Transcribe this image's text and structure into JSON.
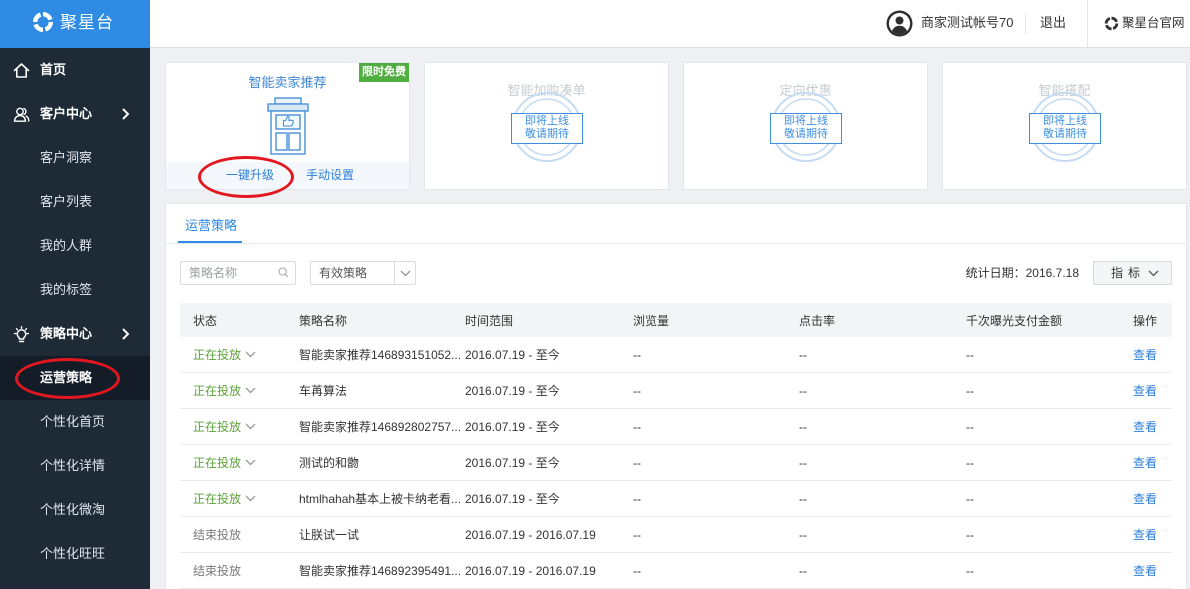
{
  "app": {
    "logo_text": "聚星台",
    "logo_icon": "juxingtai-logo-icon"
  },
  "header": {
    "avatar_icon": "user-avatar-icon",
    "account_name": "商家测试帐号70",
    "logout_label": "退出",
    "official_site_label": "聚星台官网"
  },
  "sidebar": {
    "items": [
      {
        "label": "首页",
        "icon": "home-icon"
      },
      {
        "label": "客户中心",
        "icon": "user-group-icon",
        "expandable": true
      },
      {
        "label": "客户洞察"
      },
      {
        "label": "客户列表"
      },
      {
        "label": "我的人群"
      },
      {
        "label": "我的标签"
      },
      {
        "label": "策略中心",
        "icon": "bulb-icon",
        "expandable": true
      },
      {
        "label": "运营策略",
        "selected": true
      },
      {
        "label": "个性化首页"
      },
      {
        "label": "个性化详情"
      },
      {
        "label": "个性化微淘"
      },
      {
        "label": "个性化旺旺"
      }
    ]
  },
  "feature_cards": [
    {
      "title": "智能卖家推荐",
      "badge": "限时免费",
      "icon": "shop-thumbs-up-icon",
      "actions": [
        "一键升级",
        "手动设置"
      ]
    },
    {
      "title": "智能加购凑单",
      "stamp": [
        "即将上线",
        "敬请期待"
      ]
    },
    {
      "title": "定向优惠",
      "stamp": [
        "即将上线",
        "敬请期待"
      ]
    },
    {
      "title": "智能搭配",
      "stamp": [
        "即将上线",
        "敬请期待"
      ]
    }
  ],
  "panel": {
    "tab_label": "运营策略",
    "search_placeholder": "策略名称",
    "filter_value": "有效策略",
    "stat_date": "统计日期：2016.7.18",
    "metrics_button": "指标"
  },
  "table": {
    "columns": [
      "状态",
      "策略名称",
      "时间范围",
      "浏览量",
      "点击率",
      "千次曝光支付金额",
      "操作"
    ],
    "rows": [
      {
        "status": "正在投放",
        "name": "智能卖家推荐146893151052...",
        "time_range": "2016.07.19 - 至今",
        "views": "--",
        "click_rate": "--",
        "gmv_per_mille": "--",
        "action": "查看"
      },
      {
        "status": "正在投放",
        "name": "车苒算法",
        "time_range": "2016.07.19 - 至今",
        "views": "--",
        "click_rate": "--",
        "gmv_per_mille": "--",
        "action": "查看"
      },
      {
        "status": "正在投放",
        "name": "智能卖家推荐146892802757...",
        "time_range": "2016.07.19 - 至今",
        "views": "--",
        "click_rate": "--",
        "gmv_per_mille": "--",
        "action": "查看"
      },
      {
        "status": "正在投放",
        "name": "测试的和朆",
        "time_range": "2016.07.19 - 至今",
        "views": "--",
        "click_rate": "--",
        "gmv_per_mille": "--",
        "action": "查看"
      },
      {
        "status": "正在投放",
        "name": "htmlhahah基本上被卡纳老看...",
        "time_range": "2016.07.19 - 至今",
        "views": "--",
        "click_rate": "--",
        "gmv_per_mille": "--",
        "action": "查看"
      },
      {
        "status": "结束投放",
        "name": "让朕试一试",
        "time_range": "2016.07.19 - 2016.07.19",
        "views": "--",
        "click_rate": "--",
        "gmv_per_mille": "--",
        "action": "查看"
      },
      {
        "status": "结束投放",
        "name": "智能卖家推荐146892395491...",
        "time_range": "2016.07.19 - 2016.07.19",
        "views": "--",
        "click_rate": "--",
        "gmv_per_mille": "--",
        "action": "查看"
      }
    ]
  },
  "colors": {
    "sidebar_bg": "#1f2a37",
    "logo_bar_bg": "#2f8be4",
    "accent_blue": "#2d8ae6",
    "link_blue": "#2d7fd8",
    "badge_green": "#4fae3f",
    "status_active": "#5ca13a",
    "status_ended": "#7a7a7a",
    "annotation_red": "#e3171f"
  }
}
